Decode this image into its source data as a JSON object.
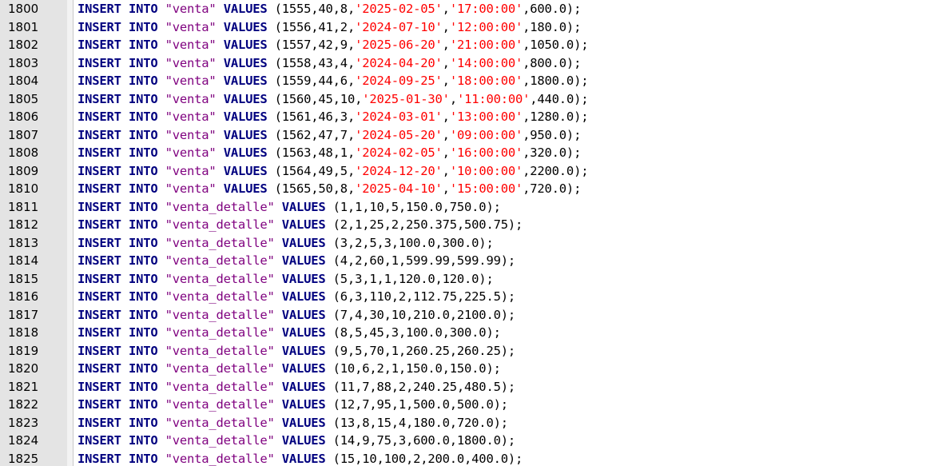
{
  "editor": {
    "colors": {
      "keyword": "#00007f",
      "identifier": "#7f007f",
      "string": "#ff0000",
      "gutter": "#e4e4e4"
    },
    "lines": [
      {
        "n": "1800",
        "table": "\"venta\"",
        "values": "(1555,40,8,",
        "s1": "'2025-02-05'",
        "c1": ",",
        "s2": "'17:00:00'",
        "tail": ",600.0);"
      },
      {
        "n": "1801",
        "table": "\"venta\"",
        "values": "(1556,41,2,",
        "s1": "'2024-07-10'",
        "c1": ",",
        "s2": "'12:00:00'",
        "tail": ",180.0);"
      },
      {
        "n": "1802",
        "table": "\"venta\"",
        "values": "(1557,42,9,",
        "s1": "'2025-06-20'",
        "c1": ",",
        "s2": "'21:00:00'",
        "tail": ",1050.0);"
      },
      {
        "n": "1803",
        "table": "\"venta\"",
        "values": "(1558,43,4,",
        "s1": "'2024-04-20'",
        "c1": ",",
        "s2": "'14:00:00'",
        "tail": ",800.0);"
      },
      {
        "n": "1804",
        "table": "\"venta\"",
        "values": "(1559,44,6,",
        "s1": "'2024-09-25'",
        "c1": ",",
        "s2": "'18:00:00'",
        "tail": ",1800.0);"
      },
      {
        "n": "1805",
        "table": "\"venta\"",
        "values": "(1560,45,10,",
        "s1": "'2025-01-30'",
        "c1": ",",
        "s2": "'11:00:00'",
        "tail": ",440.0);"
      },
      {
        "n": "1806",
        "table": "\"venta\"",
        "values": "(1561,46,3,",
        "s1": "'2024-03-01'",
        "c1": ",",
        "s2": "'13:00:00'",
        "tail": ",1280.0);"
      },
      {
        "n": "1807",
        "table": "\"venta\"",
        "values": "(1562,47,7,",
        "s1": "'2024-05-20'",
        "c1": ",",
        "s2": "'09:00:00'",
        "tail": ",950.0);"
      },
      {
        "n": "1808",
        "table": "\"venta\"",
        "values": "(1563,48,1,",
        "s1": "'2024-02-05'",
        "c1": ",",
        "s2": "'16:00:00'",
        "tail": ",320.0);"
      },
      {
        "n": "1809",
        "table": "\"venta\"",
        "values": "(1564,49,5,",
        "s1": "'2024-12-20'",
        "c1": ",",
        "s2": "'10:00:00'",
        "tail": ",2200.0);"
      },
      {
        "n": "1810",
        "table": "\"venta\"",
        "values": "(1565,50,8,",
        "s1": "'2025-04-10'",
        "c1": ",",
        "s2": "'15:00:00'",
        "tail": ",720.0);"
      },
      {
        "n": "1811",
        "table": "\"venta_detalle\"",
        "values": "(1,1,10,5,150.0,750.0);"
      },
      {
        "n": "1812",
        "table": "\"venta_detalle\"",
        "values": "(2,1,25,2,250.375,500.75);"
      },
      {
        "n": "1813",
        "table": "\"venta_detalle\"",
        "values": "(3,2,5,3,100.0,300.0);"
      },
      {
        "n": "1814",
        "table": "\"venta_detalle\"",
        "values": "(4,2,60,1,599.99,599.99);"
      },
      {
        "n": "1815",
        "table": "\"venta_detalle\"",
        "values": "(5,3,1,1,120.0,120.0);"
      },
      {
        "n": "1816",
        "table": "\"venta_detalle\"",
        "values": "(6,3,110,2,112.75,225.5);"
      },
      {
        "n": "1817",
        "table": "\"venta_detalle\"",
        "values": "(7,4,30,10,210.0,2100.0);"
      },
      {
        "n": "1818",
        "table": "\"venta_detalle\"",
        "values": "(8,5,45,3,100.0,300.0);"
      },
      {
        "n": "1819",
        "table": "\"venta_detalle\"",
        "values": "(9,5,70,1,260.25,260.25);"
      },
      {
        "n": "1820",
        "table": "\"venta_detalle\"",
        "values": "(10,6,2,1,150.0,150.0);"
      },
      {
        "n": "1821",
        "table": "\"venta_detalle\"",
        "values": "(11,7,88,2,240.25,480.5);"
      },
      {
        "n": "1822",
        "table": "\"venta_detalle\"",
        "values": "(12,7,95,1,500.0,500.0);"
      },
      {
        "n": "1823",
        "table": "\"venta_detalle\"",
        "values": "(13,8,15,4,180.0,720.0);"
      },
      {
        "n": "1824",
        "table": "\"venta_detalle\"",
        "values": "(14,9,75,3,600.0,1800.0);"
      },
      {
        "n": "1825",
        "table": "\"venta_detalle\"",
        "values": "(15,10,100,2,200.0,400.0);"
      }
    ]
  }
}
